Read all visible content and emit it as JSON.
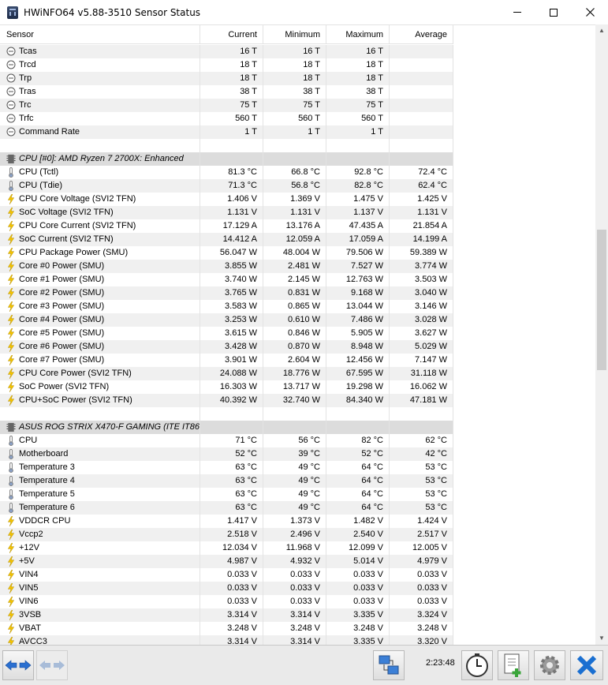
{
  "window": {
    "title": "HWiNFO64 v5.88-3510 Sensor Status",
    "minimize_icon": "minimize-icon",
    "maximize_icon": "maximize-icon",
    "close_icon": "close-icon"
  },
  "columns": {
    "sensor": "Sensor",
    "current": "Current",
    "minimum": "Minimum",
    "maximum": "Maximum",
    "average": "Average"
  },
  "rows": [
    {
      "kind": "item",
      "icon": "clock",
      "name": "Tcas",
      "cur": "16 T",
      "min": "16 T",
      "max": "16 T",
      "avg": ""
    },
    {
      "kind": "item",
      "icon": "clock",
      "name": "Trcd",
      "cur": "18 T",
      "min": "18 T",
      "max": "18 T",
      "avg": ""
    },
    {
      "kind": "item",
      "icon": "clock",
      "name": "Trp",
      "cur": "18 T",
      "min": "18 T",
      "max": "18 T",
      "avg": ""
    },
    {
      "kind": "item",
      "icon": "clock",
      "name": "Tras",
      "cur": "38 T",
      "min": "38 T",
      "max": "38 T",
      "avg": ""
    },
    {
      "kind": "item",
      "icon": "clock",
      "name": "Trc",
      "cur": "75 T",
      "min": "75 T",
      "max": "75 T",
      "avg": ""
    },
    {
      "kind": "item",
      "icon": "clock",
      "name": "Trfc",
      "cur": "560 T",
      "min": "560 T",
      "max": "560 T",
      "avg": ""
    },
    {
      "kind": "item",
      "icon": "clock",
      "name": "Command Rate",
      "cur": "1 T",
      "min": "1 T",
      "max": "1 T",
      "avg": ""
    },
    {
      "kind": "blank"
    },
    {
      "kind": "group",
      "icon": "chip",
      "name": "CPU [#0]: AMD Ryzen 7 2700X: Enhanced"
    },
    {
      "kind": "item",
      "icon": "thermometer",
      "name": "CPU (Tctl)",
      "cur": "81.3 °C",
      "min": "66.8 °C",
      "max": "92.8 °C",
      "avg": "72.4 °C"
    },
    {
      "kind": "item",
      "icon": "thermometer",
      "name": "CPU (Tdie)",
      "cur": "71.3 °C",
      "min": "56.8 °C",
      "max": "82.8 °C",
      "avg": "62.4 °C"
    },
    {
      "kind": "item",
      "icon": "bolt",
      "name": "CPU Core Voltage (SVI2 TFN)",
      "cur": "1.406 V",
      "min": "1.369 V",
      "max": "1.475 V",
      "avg": "1.425 V"
    },
    {
      "kind": "item",
      "icon": "bolt",
      "name": "SoC Voltage (SVI2 TFN)",
      "cur": "1.131 V",
      "min": "1.131 V",
      "max": "1.137 V",
      "avg": "1.131 V"
    },
    {
      "kind": "item",
      "icon": "bolt",
      "name": "CPU Core Current (SVI2 TFN)",
      "cur": "17.129 A",
      "min": "13.176 A",
      "max": "47.435 A",
      "avg": "21.854 A"
    },
    {
      "kind": "item",
      "icon": "bolt",
      "name": "SoC Current (SVI2 TFN)",
      "cur": "14.412 A",
      "min": "12.059 A",
      "max": "17.059 A",
      "avg": "14.199 A"
    },
    {
      "kind": "item",
      "icon": "bolt",
      "name": "CPU Package Power (SMU)",
      "cur": "56.047 W",
      "min": "48.004 W",
      "max": "79.506 W",
      "avg": "59.389 W"
    },
    {
      "kind": "item",
      "icon": "bolt",
      "name": "Core #0 Power (SMU)",
      "cur": "3.855 W",
      "min": "2.481 W",
      "max": "7.527 W",
      "avg": "3.774 W"
    },
    {
      "kind": "item",
      "icon": "bolt",
      "name": "Core #1 Power (SMU)",
      "cur": "3.740 W",
      "min": "2.145 W",
      "max": "12.763 W",
      "avg": "3.503 W"
    },
    {
      "kind": "item",
      "icon": "bolt",
      "name": "Core #2 Power (SMU)",
      "cur": "3.765 W",
      "min": "0.831 W",
      "max": "9.168 W",
      "avg": "3.040 W"
    },
    {
      "kind": "item",
      "icon": "bolt",
      "name": "Core #3 Power (SMU)",
      "cur": "3.583 W",
      "min": "0.865 W",
      "max": "13.044 W",
      "avg": "3.146 W"
    },
    {
      "kind": "item",
      "icon": "bolt",
      "name": "Core #4 Power (SMU)",
      "cur": "3.253 W",
      "min": "0.610 W",
      "max": "7.486 W",
      "avg": "3.028 W"
    },
    {
      "kind": "item",
      "icon": "bolt",
      "name": "Core #5 Power (SMU)",
      "cur": "3.615 W",
      "min": "0.846 W",
      "max": "5.905 W",
      "avg": "3.627 W"
    },
    {
      "kind": "item",
      "icon": "bolt",
      "name": "Core #6 Power (SMU)",
      "cur": "3.428 W",
      "min": "0.870 W",
      "max": "8.948 W",
      "avg": "5.029 W"
    },
    {
      "kind": "item",
      "icon": "bolt",
      "name": "Core #7 Power (SMU)",
      "cur": "3.901 W",
      "min": "2.604 W",
      "max": "12.456 W",
      "avg": "7.147 W"
    },
    {
      "kind": "item",
      "icon": "bolt",
      "name": "CPU Core Power (SVI2 TFN)",
      "cur": "24.088 W",
      "min": "18.776 W",
      "max": "67.595 W",
      "avg": "31.118 W"
    },
    {
      "kind": "item",
      "icon": "bolt",
      "name": "SoC Power (SVI2 TFN)",
      "cur": "16.303 W",
      "min": "13.717 W",
      "max": "19.298 W",
      "avg": "16.062 W"
    },
    {
      "kind": "item",
      "icon": "bolt",
      "name": "CPU+SoC Power (SVI2 TFN)",
      "cur": "40.392 W",
      "min": "32.740 W",
      "max": "84.340 W",
      "avg": "47.181 W"
    },
    {
      "kind": "blank"
    },
    {
      "kind": "group",
      "icon": "chip",
      "name": "ASUS ROG STRIX X470-F GAMING (ITE IT86..."
    },
    {
      "kind": "item",
      "icon": "thermometer",
      "name": "CPU",
      "cur": "71 °C",
      "min": "56 °C",
      "max": "82 °C",
      "avg": "62 °C"
    },
    {
      "kind": "item",
      "icon": "thermometer",
      "name": "Motherboard",
      "cur": "52 °C",
      "min": "39 °C",
      "max": "52 °C",
      "avg": "42 °C"
    },
    {
      "kind": "item",
      "icon": "thermometer",
      "name": "Temperature 3",
      "cur": "63 °C",
      "min": "49 °C",
      "max": "64 °C",
      "avg": "53 °C"
    },
    {
      "kind": "item",
      "icon": "thermometer",
      "name": "Temperature 4",
      "cur": "63 °C",
      "min": "49 °C",
      "max": "64 °C",
      "avg": "53 °C"
    },
    {
      "kind": "item",
      "icon": "thermometer",
      "name": "Temperature 5",
      "cur": "63 °C",
      "min": "49 °C",
      "max": "64 °C",
      "avg": "53 °C"
    },
    {
      "kind": "item",
      "icon": "thermometer",
      "name": "Temperature 6",
      "cur": "63 °C",
      "min": "49 °C",
      "max": "64 °C",
      "avg": "53 °C"
    },
    {
      "kind": "item",
      "icon": "bolt",
      "name": "VDDCR CPU",
      "cur": "1.417 V",
      "min": "1.373 V",
      "max": "1.482 V",
      "avg": "1.424 V"
    },
    {
      "kind": "item",
      "icon": "bolt",
      "name": "Vccp2",
      "cur": "2.518 V",
      "min": "2.496 V",
      "max": "2.540 V",
      "avg": "2.517 V"
    },
    {
      "kind": "item",
      "icon": "bolt",
      "name": "+12V",
      "cur": "12.034 V",
      "min": "11.968 V",
      "max": "12.099 V",
      "avg": "12.005 V"
    },
    {
      "kind": "item",
      "icon": "bolt",
      "name": "+5V",
      "cur": "4.987 V",
      "min": "4.932 V",
      "max": "5.014 V",
      "avg": "4.979 V"
    },
    {
      "kind": "item",
      "icon": "bolt",
      "name": "VIN4",
      "cur": "0.033 V",
      "min": "0.033 V",
      "max": "0.033 V",
      "avg": "0.033 V"
    },
    {
      "kind": "item",
      "icon": "bolt",
      "name": "VIN5",
      "cur": "0.033 V",
      "min": "0.033 V",
      "max": "0.033 V",
      "avg": "0.033 V"
    },
    {
      "kind": "item",
      "icon": "bolt",
      "name": "VIN6",
      "cur": "0.033 V",
      "min": "0.033 V",
      "max": "0.033 V",
      "avg": "0.033 V"
    },
    {
      "kind": "item",
      "icon": "bolt",
      "name": "3VSB",
      "cur": "3.314 V",
      "min": "3.314 V",
      "max": "3.335 V",
      "avg": "3.324 V"
    },
    {
      "kind": "item",
      "icon": "bolt",
      "name": "VBAT",
      "cur": "3.248 V",
      "min": "3.248 V",
      "max": "3.248 V",
      "avg": "3.248 V"
    },
    {
      "kind": "item",
      "icon": "bolt",
      "name": "AVCC3",
      "cur": "3.314 V",
      "min": "3.314 V",
      "max": "3.335 V",
      "avg": "3.320 V"
    }
  ],
  "toolbar": {
    "elapsed_time": "2:23:48",
    "nav_icon": "double-arrow-icon",
    "nav_icon_disabled": "double-arrow-disabled-icon",
    "network_icon": "network-icon",
    "clock_icon": "clock-reset-icon",
    "report_icon": "add-report-icon",
    "settings_icon": "gear-icon",
    "close_icon": "close-icon"
  },
  "colors": {
    "alt_row": "#f0f0f0",
    "group_row": "#dcdcdc",
    "bolt": "#f2c200",
    "accent_blue": "#1a6fd1"
  }
}
